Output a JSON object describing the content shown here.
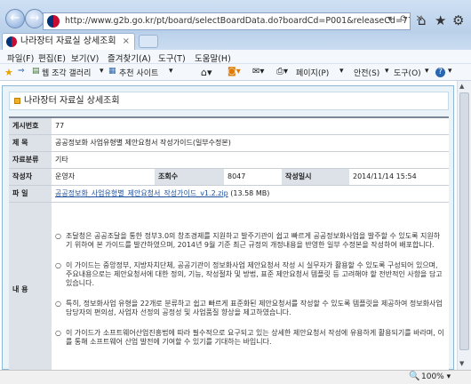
{
  "browser": {
    "url": "http://www.g2b.go.kr/pt/board/selectBoardData.do?boardCd=P001&releaseCd=77",
    "tab_title": "나라장터 자료실 상세조회",
    "zoom": "100%"
  },
  "menu": [
    "파일(F)",
    "편집(E)",
    "보기(V)",
    "즐겨찾기(A)",
    "도구(T)",
    "도움말(H)"
  ],
  "favbar": {
    "web_slice_gallery": "웹 조각 갤러리",
    "suggested_sites": "추천 사이트",
    "page": "페이지(P)",
    "safety": "안전(S)",
    "tools": "도구(O)"
  },
  "page": {
    "title": "나라장터 자료실 상세조회",
    "labels": {
      "post_no": "게시번호",
      "subject": "제 목",
      "category": "자료분류",
      "author": "작성자",
      "views": "조회수",
      "date": "작성일시",
      "file": "파 일",
      "content": "내 용"
    },
    "values": {
      "post_no": "77",
      "subject": "공공정보화 사업유형별 제안요청서 작성가이드(일부수정본)",
      "category": "기타",
      "author": "운영자",
      "views": "8047",
      "date": "2014/11/14 15:54",
      "file_name": "공공정보화_사업유형별_제안요청서_작성가이드_v1.2.zip",
      "file_size": "(13.58 MB)"
    },
    "content_paragraphs": [
      "조달청은 공공조달을 통한 정부3.0의 창조경제를 지원하고 발주기관이 쉽고 빠르게 공공정보화사업을 발주할 수 있도록 지원하기 위하여 본 가이드를 발간하였으며, 2014년 9월 기준 최근 규정의 개정내용을 반영한 일부 수정본을 작성하여 배포합니다.",
      "이 가이드는 중앙정부, 지방자치단체, 공공기관이 정보화사업 제안요청서 작성 시 실무자가 활용할 수 있도록 구성되어 있으며, 주요내용으로는 제안요청서에 대한 정의, 기능, 작성절차 및 방법, 표준 제안요청서 템플릿 등 고려해야 할 전반적인 사항을 담고 있습니다.",
      "특히, 정보화사업 유형을 22개로 분류하고 쉽고 빠르게 표준화된 제안요청서를 작성할 수 있도록 템플릿을 제공하여 정보화사업 담당자의 편의성, 사업자 선정의 공정성 및 사업품질 향상을 제고하였습니다.",
      "이 가이드가 소프트웨어산업진흥법에 따라 필수적으로 요구되고 있는 상세한 제안요청서 작성에 유용하게 활용되기를 바라며, 이를 통해 소프트웨어 산업 발전에 기여할 수 있기를 기대하는 바입니다."
    ]
  }
}
